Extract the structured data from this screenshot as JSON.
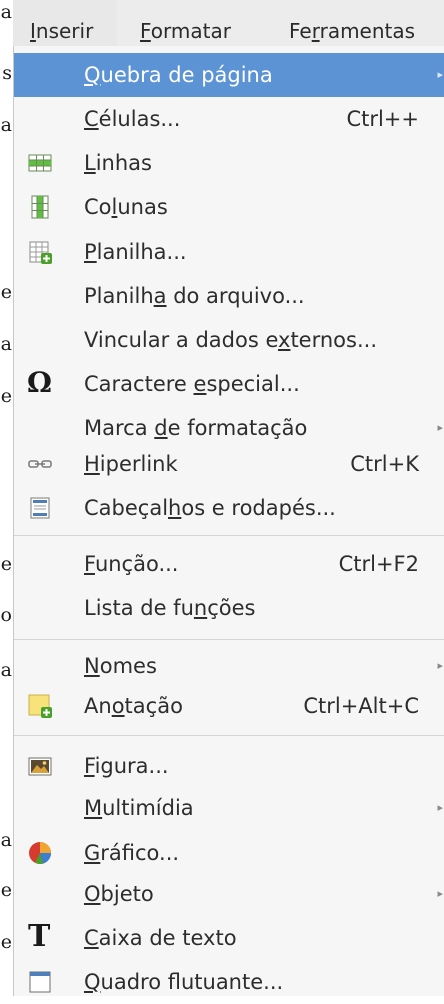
{
  "background_letters": [
    "a",
    "s",
    "a",
    "e",
    "a",
    "e",
    "e",
    "o",
    "a",
    "a",
    "e",
    "e"
  ],
  "menubar": {
    "inserir": {
      "pre": "",
      "u": "I",
      "post": "nserir"
    },
    "formatar": {
      "pre": "",
      "u": "F",
      "post": "ormatar"
    },
    "ferramentas": {
      "pre": "Fe",
      "u": "r",
      "post": "ramentas"
    }
  },
  "menu": {
    "quebra": {
      "pre": "",
      "u": "Q",
      "post": "uebra de página"
    },
    "celulas": {
      "pre": "",
      "u": "C",
      "post": "élulas...",
      "shortcut": "Ctrl++"
    },
    "linhas": {
      "pre": "",
      "u": "L",
      "post": "inhas"
    },
    "colunas": {
      "pre": "Co",
      "u": "l",
      "post": "unas"
    },
    "planilha": {
      "pre": "",
      "u": "P",
      "post": "lanilha..."
    },
    "planilha_arquivo": {
      "pre": "Planilh",
      "u": "a",
      "post": " do arquivo..."
    },
    "vincular": {
      "pre": "Vincular a dados e",
      "u": "x",
      "post": "ternos..."
    },
    "caractere": {
      "pre": "Caractere ",
      "u": "e",
      "post": "special..."
    },
    "marca": {
      "pre": "Marca ",
      "u": "d",
      "post": "e formatação"
    },
    "hiperlink": {
      "pre": "",
      "u": "H",
      "post": "iperlink",
      "shortcut": "Ctrl+K"
    },
    "cabecalhos": {
      "pre": "Cabeçal",
      "u": "h",
      "post": "os e rodapés..."
    },
    "funcao": {
      "pre": "",
      "u": "F",
      "post": "unção...",
      "shortcut": "Ctrl+F2"
    },
    "lista_funcoes": {
      "pre": "Lista de fu",
      "u": "n",
      "post": "ções"
    },
    "nomes": {
      "pre": "",
      "u": "N",
      "post": "omes"
    },
    "anotacao": {
      "pre": "An",
      "u": "o",
      "post": "tação",
      "shortcut": "Ctrl+Alt+C"
    },
    "figura": {
      "pre": "",
      "u": "F",
      "post": "igura..."
    },
    "multimidia": {
      "pre": "",
      "u": "M",
      "post": "ultimídia"
    },
    "grafico": {
      "pre": "",
      "u": "G",
      "post": "ráfico..."
    },
    "objeto": {
      "pre": "",
      "u": "O",
      "post": "bjeto"
    },
    "caixa_texto": {
      "pre": "",
      "u": "C",
      "post": "aixa de texto"
    },
    "quadro": {
      "pre": "",
      "u": "Q",
      "post": "uadro flutuante..."
    }
  },
  "icons": {
    "omega_glyph": "Ω",
    "text_glyph": "T",
    "submenu_glyph": "▸"
  },
  "colors": {
    "highlight": "#5b93d4",
    "menu_bg": "#f6f6f6",
    "menubar_bg": "#ececec"
  }
}
